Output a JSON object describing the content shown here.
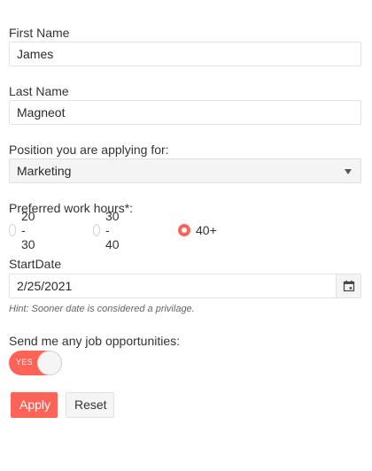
{
  "form": {
    "first_name": {
      "label": "First Name",
      "value": "James"
    },
    "last_name": {
      "label": "Last Name",
      "value": "Magneot"
    },
    "position": {
      "label": "Position you are applying for:",
      "selected": "Marketing"
    },
    "work_hours": {
      "label": "Preferred work hours*:",
      "options": [
        "20 - 30",
        "30 - 40",
        "40+"
      ],
      "selected": "40+"
    },
    "start_date": {
      "label": "StartDate",
      "value": "2/25/2021",
      "hint": "Hint: Sooner date is considered a privilage."
    },
    "job_opportunities": {
      "label": "Send me any job opportunities:",
      "switch_label": "YES",
      "on": true
    },
    "buttons": {
      "apply": "Apply",
      "reset": "Reset"
    }
  },
  "colors": {
    "accent": "#ff6358",
    "border": "#e2e2e2",
    "select_bg": "#f4f4f4"
  },
  "icons": {
    "dropdown": "caret-down-icon",
    "calendar": "calendar-icon"
  }
}
